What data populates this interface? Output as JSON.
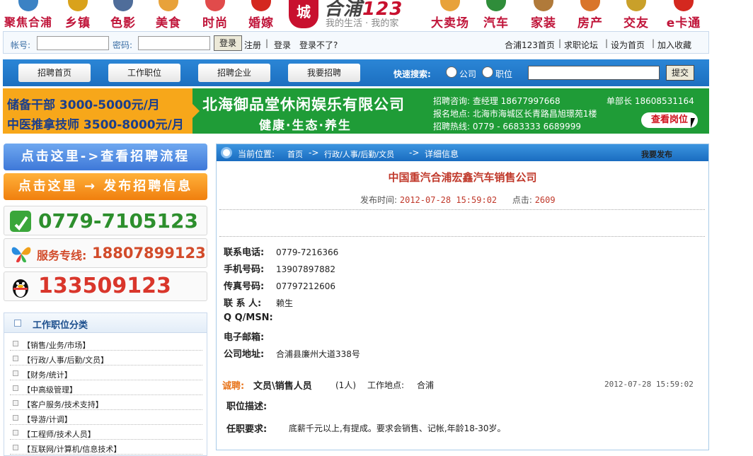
{
  "nav": {
    "items": [
      {
        "label": "聚焦合浦",
        "icon": "news-globe-icon",
        "color": "#3b82c4"
      },
      {
        "label": "乡镇",
        "icon": "town-icon",
        "color": "#d9a21b"
      },
      {
        "label": "色影",
        "icon": "camera-icon",
        "color": "#4f6d9a"
      },
      {
        "label": "美食",
        "icon": "food-bowl-icon",
        "color": "#e8a23a"
      },
      {
        "label": "时尚",
        "icon": "fashion-bag-icon",
        "color": "#e14b4b"
      },
      {
        "label": "婚嫁",
        "icon": "wedding-lantern-icon",
        "color": "#d4281f"
      }
    ],
    "right_items": [
      {
        "label": "大卖场",
        "icon": "shopping-cart-icon",
        "color": "#e8a23a"
      },
      {
        "label": "汽车",
        "icon": "car-icon",
        "color": "#2f8d3a"
      },
      {
        "label": "家装",
        "icon": "home-decor-icon",
        "color": "#b07a3a"
      },
      {
        "label": "房产",
        "icon": "house-icon",
        "color": "#d9752a"
      },
      {
        "label": "交友",
        "icon": "friends-icon",
        "color": "#c9a02a"
      },
      {
        "label": "e卡通",
        "icon": "e-card-icon",
        "color": "#d4281f"
      }
    ],
    "logo": {
      "seal": "城",
      "brand": "合浦",
      "brand_num": "123",
      "slogan": "我的生活 · 我的家"
    }
  },
  "login": {
    "account_label": "帐号:",
    "password_label": "密码:",
    "login_button": "登录",
    "register": "注册",
    "login_link": "登录",
    "forgot": "登录不了?",
    "links": [
      "合浦123首页",
      "求职论坛",
      "设为首页",
      "加入收藏"
    ]
  },
  "menu": {
    "buttons": [
      "招聘首页",
      "工作职位",
      "招聘企业",
      "我要招聘"
    ],
    "quick_search_label": "快速搜索:",
    "radio_company": "公司",
    "radio_job": "职位",
    "submit": "提交"
  },
  "banner": {
    "left_line1": "储备干部 3000-5000元/月",
    "left_line2": "中医推拿技师 3500-8000元/月",
    "company": "北海御品堂休闲娱乐有限公司",
    "tagline": "健康·生态·养生",
    "contact_line": "招聘咨询: 查经理 18677997668",
    "manager_line": "单部长 18608531164",
    "address_line": "报名地点: 北海市海城区长青路昌旭璟苑1楼",
    "hotline_line": "招聘热线: 0779 - 6683333   6689999",
    "button": "查看岗位",
    "colors": {
      "green": "#1f9c37",
      "orange": "#f7a71a"
    }
  },
  "left": {
    "flow_button": "点击这里->查看招聘流程",
    "post_button": "点击这里 → 发布招聘信息",
    "phone": "0779-7105123",
    "service_label": "服务专线:",
    "service_number": "18807899123",
    "qq_number": "133509123",
    "category_title": "工作职位分类",
    "categories": [
      "【销售/业务/市场】",
      "【行政/人事/后勤/文员】",
      "【财务/统计】",
      "【中高级管理】",
      "【客户服务/技术支持】",
      "【导游/计调】",
      "【工程师/技术人员】",
      "【互联网/计算机/信息技术】"
    ]
  },
  "main": {
    "crumb_label": "当前位置:",
    "crumb_home": "首页",
    "crumb_sep": "->",
    "crumb_cat": "行政/人事/后勤/文员",
    "crumb_current": "详细信息",
    "publish": "我要发布",
    "title": "中国重汽合浦宏鑫汽车销售公司",
    "publish_time_label": "发布时间:",
    "publish_time": "2012-07-28 15:59:02",
    "clicks_label": "点击:",
    "clicks": "2609",
    "contact": [
      {
        "key": "联系电话:",
        "value": "0779-7216366"
      },
      {
        "key": "手机号码:",
        "value": "13907897882"
      },
      {
        "key": "传真号码:",
        "value": "07797212606"
      },
      {
        "key": "联 系 人:",
        "value": "赖生"
      },
      {
        "key": "Q Q/MSN:",
        "value": ""
      },
      {
        "key": "电子邮箱:",
        "value": ""
      },
      {
        "key": "公司地址:",
        "value": "合浦县廉州大道338号"
      }
    ],
    "hire_word": "诚聘:",
    "hire_position": "文员\\销售人员",
    "hire_count": "(1人)",
    "hire_location_label": "工作地点:",
    "hire_location": "合浦",
    "hire_date": "2012-07-28 15:59:02",
    "desc_label": "职位描述:",
    "req_label": "任职要求:",
    "req_text": "底薪千元以上,有提成。要求会销售、记帐,年龄18-30岁。"
  }
}
